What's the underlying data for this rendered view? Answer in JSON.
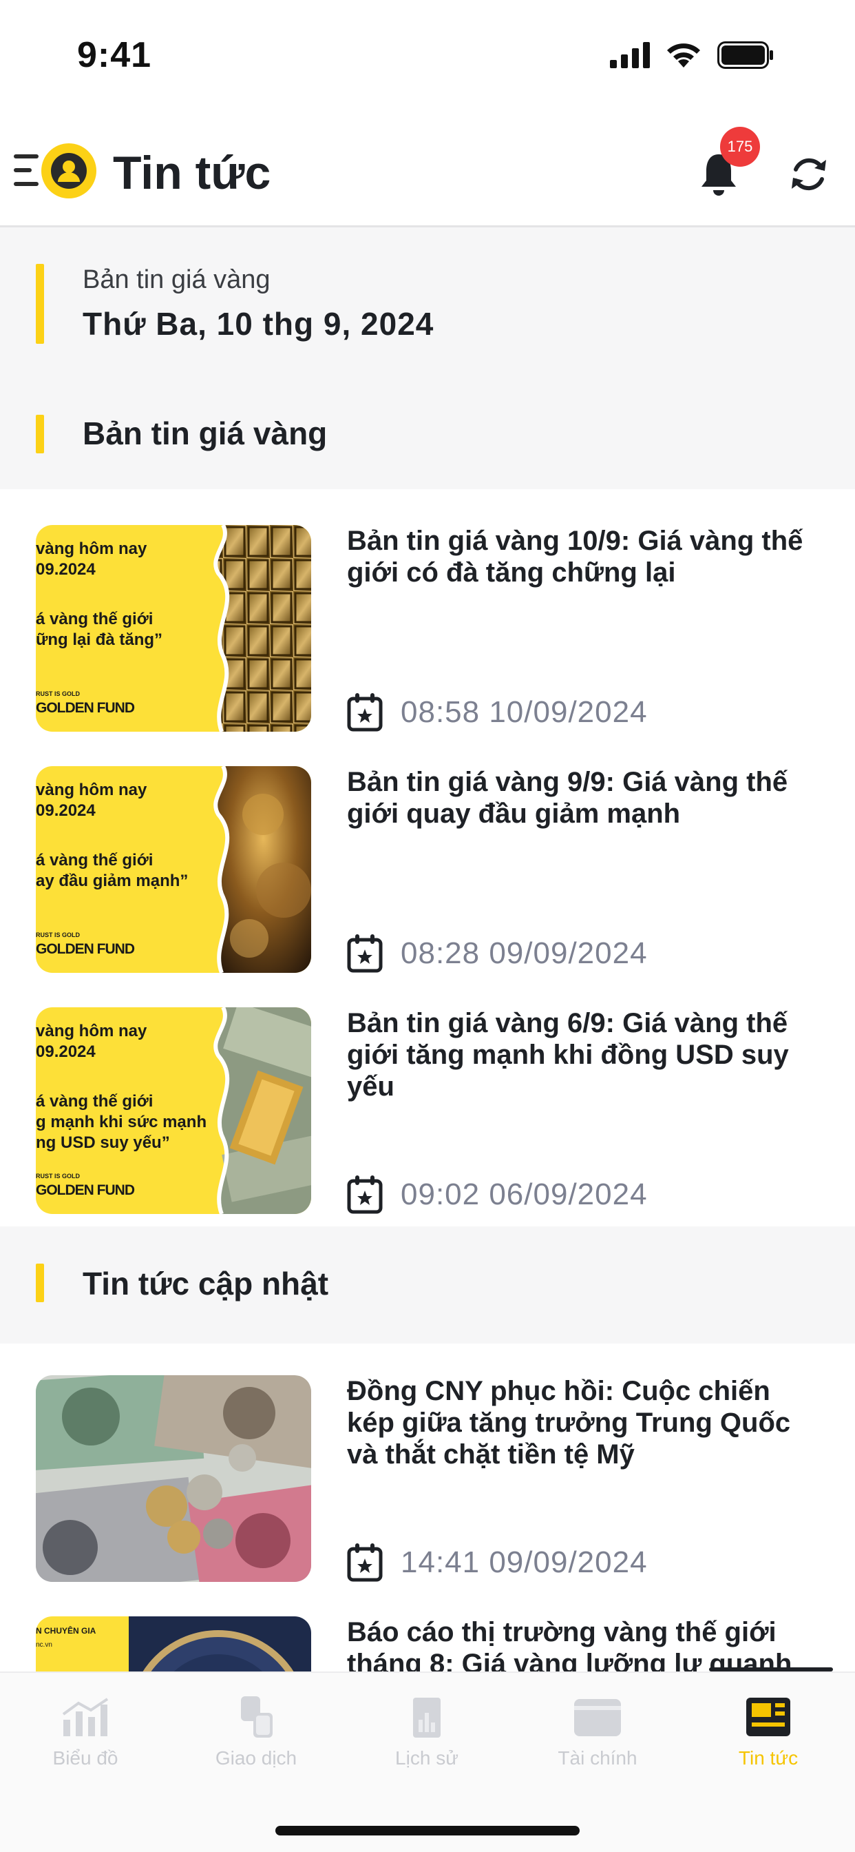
{
  "status_bar": {
    "time": "9:41"
  },
  "header": {
    "title": "Tin tức",
    "notification_count": "175"
  },
  "bulletin": {
    "label": "Bản tin giá vàng",
    "date": "Thứ Ba, 10 thg 9, 2024"
  },
  "gold_section": {
    "title": "Bản tin giá vàng",
    "items": [
      {
        "title": "Bản tin giá vàng 10/9: Giá vàng thế giới có đà tăng chững lại",
        "time": "08:58 10/09/2024",
        "thumb": {
          "line1": "vàng hôm nay",
          "line2": "09.2024",
          "line3": "á vàng thế giới",
          "line4": "ững lại đà tăng”",
          "line5": "",
          "small": "RUST IS GOLD",
          "fund": "GOLDEN FUND"
        }
      },
      {
        "title": "Bản tin giá vàng 9/9: Giá vàng thế giới quay đầu giảm mạnh",
        "time": "08:28 09/09/2024",
        "thumb": {
          "line1": "vàng hôm nay",
          "line2": "09.2024",
          "line3": "á vàng thế giới",
          "line4": "ay đầu giảm mạnh”",
          "line5": "",
          "small": "RUST IS GOLD",
          "fund": "GOLDEN FUND"
        }
      },
      {
        "title": "Bản tin giá vàng 6/9: Giá vàng thế giới tăng mạnh khi đồng USD suy yếu",
        "time": "09:02 06/09/2024",
        "thumb": {
          "line1": "vàng hôm nay",
          "line2": "09.2024",
          "line3": "á vàng thế giới",
          "line4": "g mạnh khi sức mạnh",
          "line5": "ng USD suy yếu”",
          "small": "RUST IS GOLD",
          "fund": "GOLDEN FUND"
        }
      }
    ]
  },
  "news_section": {
    "title": "Tin tức cập nhật",
    "items": [
      {
        "title": "Đồng CNY phục hồi: Cuộc chiến kép giữa tăng trưởng Trung Quốc và thắt chặt tiền tệ Mỹ",
        "time": "14:41 09/09/2024"
      },
      {
        "title": "Báo cáo thị trường vàng thế giới tháng 8: Giá vàng lưỡng lự quanh",
        "thumb_text1": "N CHUYÊN GIA",
        "thumb_text2": "nc.vn"
      }
    ]
  },
  "bottom_nav": [
    {
      "label": "Biểu đồ",
      "icon": "chart-icon"
    },
    {
      "label": "Giao dịch",
      "icon": "exchange-icon"
    },
    {
      "label": "Lịch sử",
      "icon": "history-icon"
    },
    {
      "label": "Tài chính",
      "icon": "wallet-icon"
    },
    {
      "label": "Tin tức",
      "icon": "news-icon",
      "active": true
    }
  ],
  "colors": {
    "accent": "#fcd116",
    "badge": "#ee3b3b",
    "active_nav": "#f5c400",
    "muted": "#7c8090"
  }
}
